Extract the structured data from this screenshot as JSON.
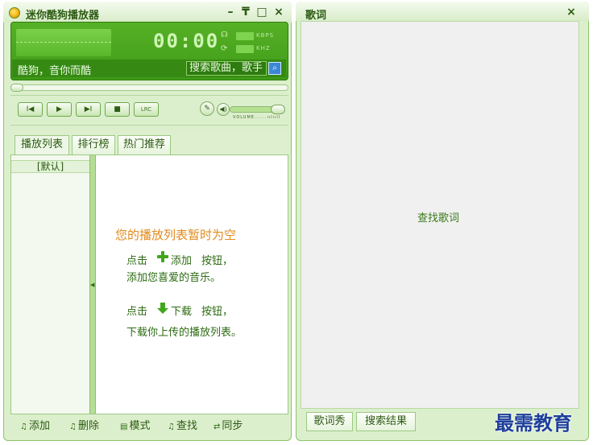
{
  "player": {
    "title": "迷你酷狗播放器",
    "window_controls": {
      "minimize": "–",
      "pin": "₸",
      "maximize": "□",
      "close": "×"
    },
    "display": {
      "time": "00:00",
      "kbps_label": "KBPS",
      "khz_label": "KHZ",
      "track_text": "酷狗，音你而酷",
      "search_placeholder": "搜索歌曲，歌手"
    },
    "progress_fraction": 0.0,
    "controls": {
      "prev": "I◀",
      "play": "▶",
      "next": "▶I",
      "stop": "■",
      "lrc": "LRC"
    },
    "volume": {
      "label": "VOLUME",
      "fraction": 0.92
    },
    "tabs": [
      "播放列表",
      "排行榜",
      "热门推荐"
    ],
    "playlist": {
      "groups": [
        "[默认]"
      ],
      "empty_title": "您的播放列表暂时为空",
      "hint_add_prefix": "点击",
      "hint_add_action": "添加",
      "hint_add_suffix": "按钮，",
      "hint_add_line2": "添加您喜爱的音乐。",
      "hint_dl_prefix": "点击",
      "hint_dl_action": "下载",
      "hint_dl_suffix": "按钮，",
      "hint_dl_line2": "下载你上传的播放列表。"
    },
    "toolbar": [
      "添加",
      "删除",
      "模式",
      "查找",
      "同步"
    ]
  },
  "lyric_window": {
    "title": "歌词",
    "close": "×",
    "search_text": "查找歌词",
    "tabs": [
      "歌词秀",
      "搜索结果"
    ]
  },
  "watermark": "最需教育",
  "colors": {
    "skin_green": "#3e9a18",
    "panel_bg": "#dcefcd",
    "accent_orange": "#e28a1d",
    "watermark_blue": "#1e3f9a"
  }
}
